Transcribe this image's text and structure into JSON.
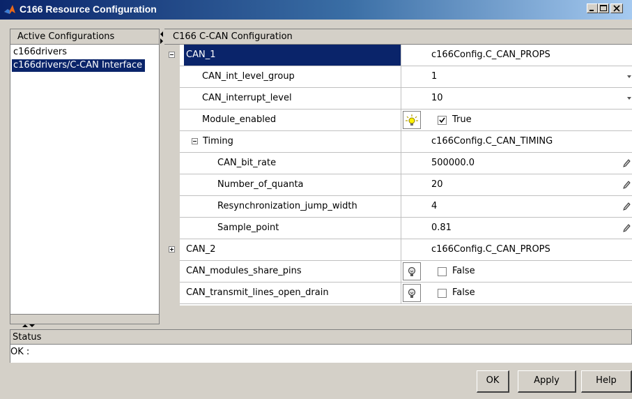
{
  "window": {
    "title": "C166 Resource Configuration",
    "controls": [
      "minimize",
      "maximize",
      "close"
    ]
  },
  "left_panel": {
    "header": "Active Configurations",
    "items": [
      {
        "label": "c166drivers",
        "selected": false
      },
      {
        "label": "c166drivers/C-CAN Interface",
        "selected": true
      }
    ]
  },
  "right_panel": {
    "header": "C166 C-CAN Configuration",
    "rows": [
      {
        "name": "CAN_1",
        "value": "c166Config.C_CAN_PROPS",
        "expander": "minus",
        "selected": true
      },
      {
        "name": "CAN_int_level_group",
        "value": "1",
        "editor": "dropdown"
      },
      {
        "name": "CAN_interrupt_level",
        "value": "10",
        "editor": "dropdown"
      },
      {
        "name": "Module_enabled",
        "value": "True",
        "editor": "checkbox",
        "checked": true,
        "bulb": "lit"
      },
      {
        "name": "Timing",
        "value": "c166Config.C_CAN_TIMING",
        "expander": "minus"
      },
      {
        "name": "CAN_bit_rate",
        "value": "500000.0",
        "editor": "pencil"
      },
      {
        "name": "Number_of_quanta",
        "value": "20",
        "editor": "pencil"
      },
      {
        "name": "Resynchronization_jump_width",
        "value": "4",
        "editor": "pencil"
      },
      {
        "name": "Sample_point",
        "value": "0.81",
        "editor": "pencil"
      },
      {
        "name": "CAN_2",
        "value": "c166Config.C_CAN_PROPS",
        "expander": "plus"
      },
      {
        "name": "CAN_modules_share_pins",
        "value": "False",
        "editor": "checkbox",
        "checked": false,
        "bulb": "unlit"
      },
      {
        "name": "CAN_transmit_lines_open_drain",
        "value": "False",
        "editor": "checkbox",
        "checked": false,
        "bulb": "unlit"
      }
    ]
  },
  "status": {
    "header": "Status",
    "text": "OK :"
  },
  "buttons": {
    "ok": "OK",
    "apply": "Apply",
    "help": "Help"
  },
  "colors": {
    "title_gradient_start": "#0a246a",
    "title_gradient_end": "#a6caf0",
    "selection": "#0a246a",
    "face": "#d4d0c8"
  }
}
